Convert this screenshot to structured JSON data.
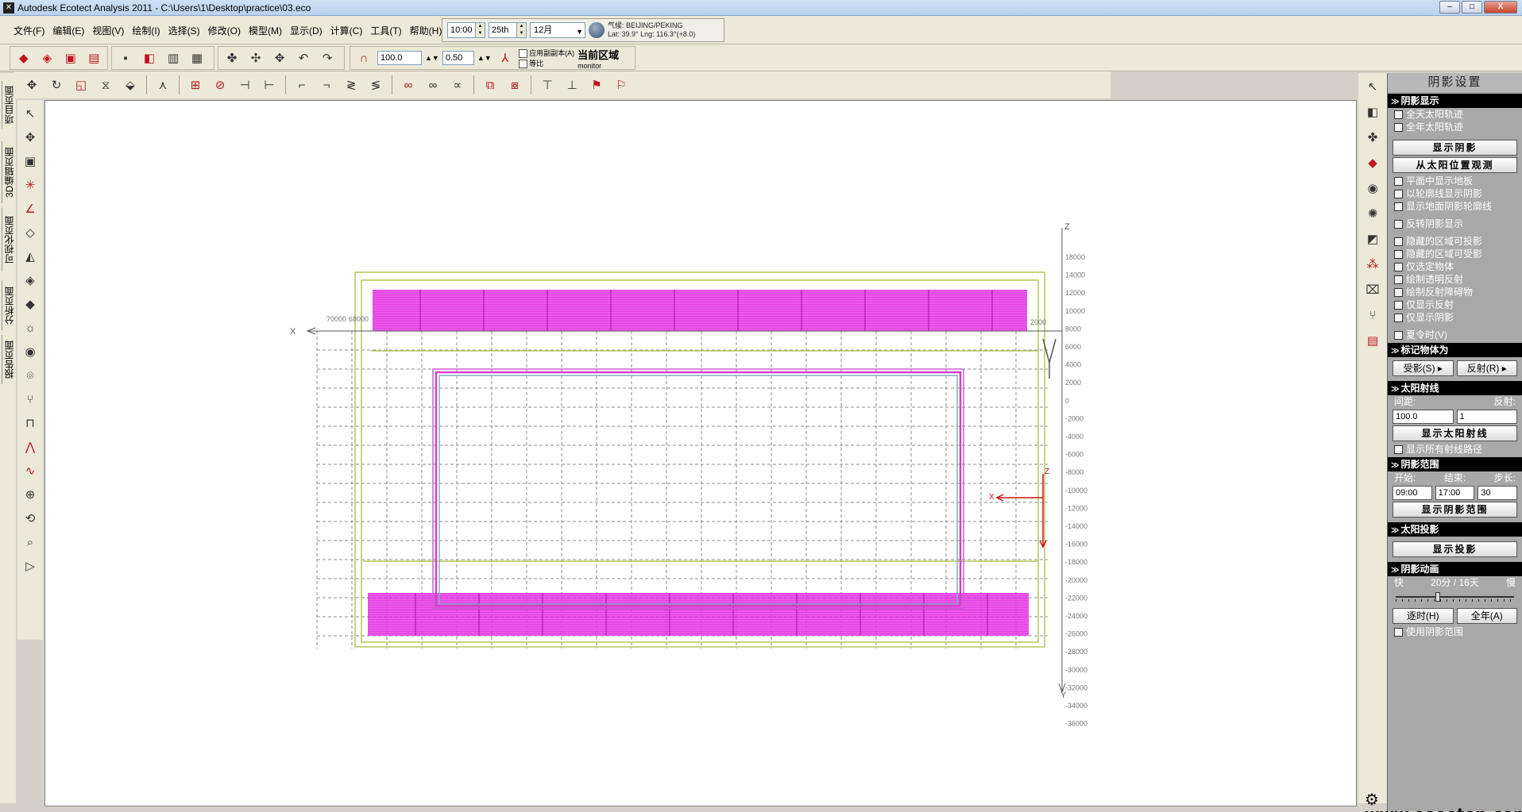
{
  "window": {
    "title": "Autodesk Ecotect Analysis 2011 - C:\\Users\\1\\Desktop\\practice\\03.eco",
    "minimize": "–",
    "maximize": "□",
    "close": "X"
  },
  "menu": [
    "文件(F)",
    "编辑(E)",
    "视图(V)",
    "绘制(I)",
    "选择(S)",
    "修改(O)",
    "模型(M)",
    "显示(D)",
    "计算(C)",
    "工具(T)",
    "帮助(H)"
  ],
  "datetime": {
    "time": "10:00",
    "day": "25th",
    "month": "12月",
    "weather_label": "气候: BEIJING/PEKING",
    "latlng": "Lat: 39.9°  Lng: 116.3°(+8.0)"
  },
  "toolbar2": {
    "scale_value": "100.0",
    "offset_value": "0.50",
    "apply_copy_label": "应用副副本(A)",
    "equal_label": "等比",
    "current_zone_label": "当前区域",
    "current_zone_value": "monitor"
  },
  "left_tabs": [
    "项目页面",
    "3D编辑页面",
    "可视化页面",
    "分析页面",
    "报告页面"
  ],
  "viewport": {
    "axis_x": "X",
    "axis_y": "Y",
    "axis_z": "Z",
    "top_left_label": "70000",
    "top_left_label2": "68000",
    "right_tick_label": "2000",
    "vertical_ticks": [
      "18000",
      "14000",
      "12000",
      "10000",
      "8000",
      "6000",
      "4000",
      "2000",
      "0",
      "-2000",
      "-4000",
      "-6000",
      "-8000",
      "-10000",
      "-12000",
      "-14000",
      "-16000",
      "-18000",
      "-20000",
      "-22000",
      "-24000",
      "-26000",
      "-28000",
      "-30000",
      "-32000",
      "-34000",
      "-36000"
    ],
    "local_axis_z": "Z",
    "local_axis_x": "X"
  },
  "panel": {
    "title": "阴影设置",
    "sec_display": "阴影显示",
    "opt_day_path": "全天太阳轨迹",
    "opt_year_path": "全年太阳轨迹",
    "btn_show_shadow": "显示阴影",
    "btn_view_from_sun": "从太阳位置观测",
    "opt_show_floor": "平面中显示地板",
    "opt_outline_shadow": "以轮廓线显示阴影",
    "opt_ground_outline": "显示地面阴影轮廓线",
    "opt_invert": "反转阴影显示",
    "opt_hidden_cast": "隐藏的区域可投影",
    "opt_hidden_receive": "隐藏的区域可受影",
    "opt_selected_only": "仅选定物体",
    "opt_transparent_reflect": "绘制透明反射",
    "opt_reflect_obstacle": "绘制反射障碍物",
    "opt_reflect_only": "仅显示反射",
    "opt_shadow_only": "仅显示阴影",
    "opt_dst": "夏令时(V)",
    "sec_mark": "标记物体为",
    "btn_shaded": "受影(S) ▸",
    "btn_reflect": "反射(R) ▸",
    "sec_rays": "太阳射线",
    "lbl_spacing": "间距:",
    "lbl_reflect": "反射:",
    "val_spacing": "100.0",
    "val_reflect": "1",
    "btn_show_rays": "显示太阳射线",
    "opt_all_paths": "显示所有射线路径",
    "sec_range": "阴影范围",
    "lbl_start": "开始:",
    "lbl_end": "结束:",
    "lbl_step": "步长:",
    "val_start": "09:00",
    "val_end": "17:00",
    "val_step": "30",
    "btn_show_range": "显示阴影范围",
    "sec_projection": "太阳投影",
    "btn_show_projection": "显示投影",
    "sec_animation": "阴影动画",
    "lbl_fast": "快",
    "lbl_speed": "20分 / 16天",
    "lbl_slow": "慢",
    "btn_hourly": "逐时(H)",
    "btn_yearly": "全年(A)",
    "opt_use_range": "使用阴影范围",
    "reflect_only_checked": true
  },
  "watermark": "www.eeeetop.com",
  "colors": {
    "magenta": "#e020e0",
    "olive": "#b6c65a",
    "panel_bg": "#a8a8a8",
    "section_bg": "#000000",
    "axis_red": "#cc1111"
  }
}
